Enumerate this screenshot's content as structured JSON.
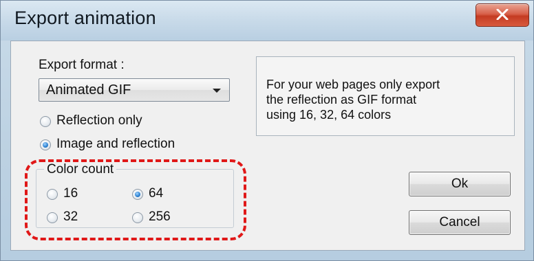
{
  "window": {
    "title": "Export animation",
    "close_icon": "close-icon"
  },
  "export_format": {
    "label": "Export format :",
    "selected": "Animated GIF"
  },
  "export_mode": {
    "options": [
      {
        "label": "Reflection only",
        "checked": false
      },
      {
        "label": "Image and reflection",
        "checked": true
      }
    ]
  },
  "color_count": {
    "legend": "Color count",
    "options": [
      {
        "label": "16",
        "checked": false
      },
      {
        "label": "64",
        "checked": true
      },
      {
        "label": "32",
        "checked": false
      },
      {
        "label": "256",
        "checked": false
      }
    ]
  },
  "info": {
    "lines": [
      "For your web pages only export",
      "the reflection as GIF format",
      "using 16, 32, 64 colors"
    ]
  },
  "buttons": {
    "ok": "Ok",
    "cancel": "Cancel"
  },
  "colors": {
    "highlight": "#e01818",
    "radio_checked": "#2a7fd0",
    "close_button": "#c43b22"
  }
}
